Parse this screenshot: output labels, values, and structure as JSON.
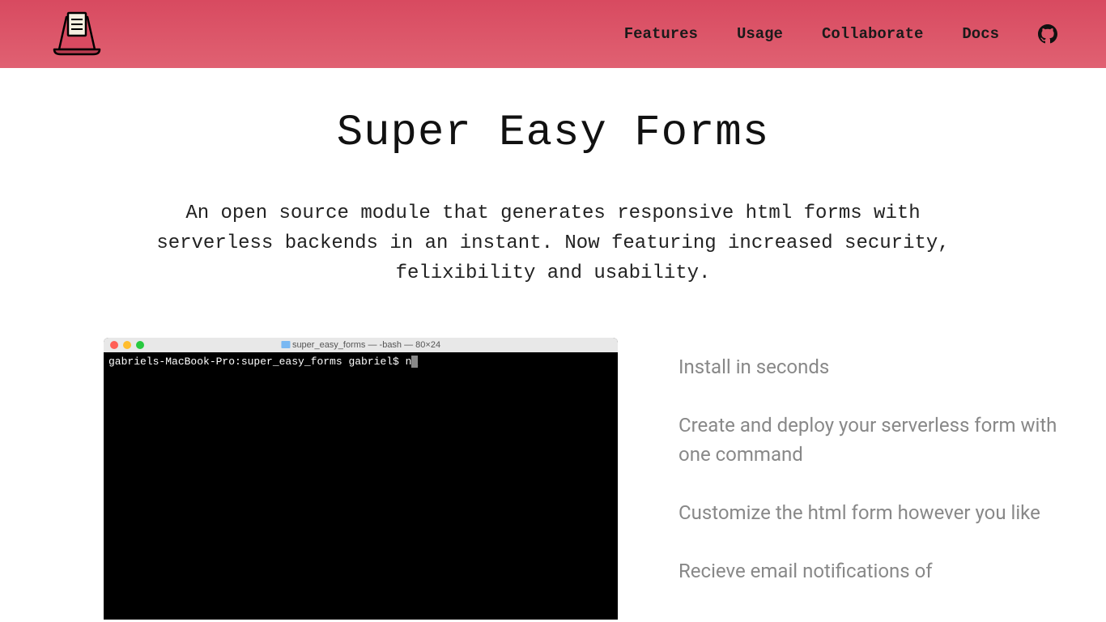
{
  "nav": {
    "links": [
      "Features",
      "Usage",
      "Collaborate",
      "Docs"
    ]
  },
  "hero": {
    "title": "Super Easy Forms",
    "subtitle": "An open source module that generates responsive html forms with serverless backends in an instant. Now featuring increased security, felixibility and usability."
  },
  "terminal": {
    "title": "super_easy_forms — -bash — 80×24",
    "prompt": "gabriels-MacBook-Pro:super_easy_forms gabriel$ n"
  },
  "features": [
    "Install in seconds",
    "Create and deploy your serverless form with one command",
    "Customize the html form however you like",
    "Recieve email notifications of"
  ]
}
